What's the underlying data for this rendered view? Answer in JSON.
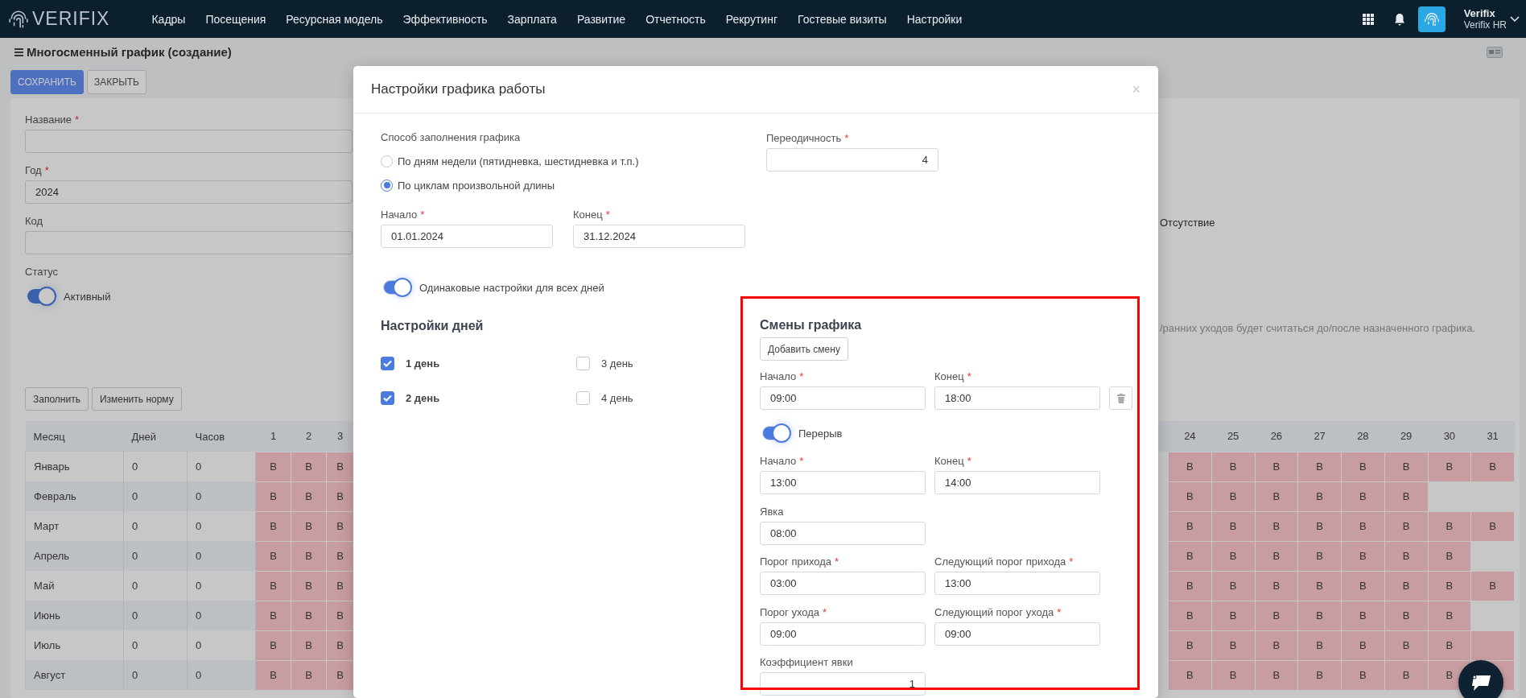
{
  "topbar": {
    "logo": "VERIFIX",
    "nav": [
      "Кадры",
      "Посещения",
      "Ресурсная модель",
      "Эффективность",
      "Зарплата",
      "Развитие",
      "Отчетность",
      "Рекрутинг",
      "Гостевые визиты",
      "Настройки"
    ],
    "user": {
      "name": "Verifix",
      "org": "Verifix HR"
    }
  },
  "page": {
    "title": "Многосменный график (создание)",
    "actions": [
      {
        "label": "СОХРАНИТЬ",
        "kind": "primary"
      },
      {
        "label": "ЗАКРЫТЬ",
        "kind": "default"
      }
    ],
    "fields": [
      {
        "label": "Название",
        "mark": "*"
      },
      {
        "label": "Год",
        "mark": "*",
        "value": "2024"
      },
      {
        "label": "Код"
      }
    ],
    "status": {
      "label": "Статус",
      "toggle": {
        "label": "Активный",
        "on": true
      }
    },
    "side_label": "Отсутствие",
    "hint": "/ранних уходов будет считаться до/после назначенного графика.",
    "table_buttons": [
      "Заполнить",
      "Изменить норму"
    ],
    "table": {
      "columns": [
        "Месяц",
        "Дней",
        "Часов",
        "1",
        "2",
        "3",
        "24",
        "25",
        "26",
        "27",
        "28",
        "29",
        "30",
        "31"
      ],
      "rows": [
        {
          "cells": [
            {
              "kind": "text",
              "text": "Январь"
            },
            {
              "kind": "text",
              "text": "0"
            },
            {
              "kind": "text",
              "text": "0"
            },
            {
              "kind": "weekend",
              "text": "В"
            },
            {
              "kind": "weekend",
              "text": "В"
            },
            {
              "kind": "weekend",
              "text": "В"
            },
            {
              "kind": "weekend",
              "text": "В"
            },
            {
              "kind": "weekend",
              "text": "В"
            },
            {
              "kind": "weekend",
              "text": "В"
            },
            {
              "kind": "weekend",
              "text": "В"
            },
            {
              "kind": "weekend",
              "text": "В"
            },
            {
              "kind": "weekend",
              "text": "В"
            },
            {
              "kind": "weekend",
              "text": "В"
            },
            {
              "kind": "weekend",
              "text": "В"
            }
          ]
        },
        {
          "cells": [
            {
              "kind": "text",
              "text": "Февраль"
            },
            {
              "kind": "text",
              "text": "0"
            },
            {
              "kind": "text",
              "text": "0"
            },
            {
              "kind": "weekend",
              "text": "В"
            },
            {
              "kind": "weekend",
              "text": "В"
            },
            {
              "kind": "weekend",
              "text": "В"
            },
            {
              "kind": "weekend",
              "text": "В"
            },
            {
              "kind": "weekend",
              "text": "В"
            },
            {
              "kind": "weekend",
              "text": "В"
            },
            {
              "kind": "weekend",
              "text": "В"
            },
            {
              "kind": "weekend",
              "text": "В"
            },
            {
              "kind": "weekend",
              "text": "В"
            },
            {
              "kind": "blank"
            },
            {
              "kind": "blank"
            }
          ]
        },
        {
          "cells": [
            {
              "kind": "text",
              "text": "Март"
            },
            {
              "kind": "text",
              "text": "0"
            },
            {
              "kind": "text",
              "text": "0"
            },
            {
              "kind": "weekend",
              "text": "В"
            },
            {
              "kind": "weekend",
              "text": "В"
            },
            {
              "kind": "weekend",
              "text": "В"
            },
            {
              "kind": "weekend",
              "text": "В"
            },
            {
              "kind": "weekend",
              "text": "В"
            },
            {
              "kind": "weekend",
              "text": "В"
            },
            {
              "kind": "weekend",
              "text": "В"
            },
            {
              "kind": "weekend",
              "text": "В"
            },
            {
              "kind": "weekend",
              "text": "В"
            },
            {
              "kind": "weekend",
              "text": "В"
            },
            {
              "kind": "weekend",
              "text": "В"
            }
          ]
        },
        {
          "cells": [
            {
              "kind": "text",
              "text": "Апрель"
            },
            {
              "kind": "text",
              "text": "0"
            },
            {
              "kind": "text",
              "text": "0"
            },
            {
              "kind": "weekend",
              "text": "В"
            },
            {
              "kind": "weekend",
              "text": "В"
            },
            {
              "kind": "weekend",
              "text": "В"
            },
            {
              "kind": "weekend",
              "text": "В"
            },
            {
              "kind": "weekend",
              "text": "В"
            },
            {
              "kind": "weekend",
              "text": "В"
            },
            {
              "kind": "weekend",
              "text": "В"
            },
            {
              "kind": "weekend",
              "text": "В"
            },
            {
              "kind": "weekend",
              "text": "В"
            },
            {
              "kind": "weekend",
              "text": "В"
            },
            {
              "kind": "blank"
            }
          ]
        },
        {
          "cells": [
            {
              "kind": "text",
              "text": "Май"
            },
            {
              "kind": "text",
              "text": "0"
            },
            {
              "kind": "text",
              "text": "0"
            },
            {
              "kind": "weekend",
              "text": "В"
            },
            {
              "kind": "weekend",
              "text": "В"
            },
            {
              "kind": "weekend",
              "text": "В"
            },
            {
              "kind": "weekend",
              "text": "В"
            },
            {
              "kind": "weekend",
              "text": "В"
            },
            {
              "kind": "weekend",
              "text": "В"
            },
            {
              "kind": "weekend",
              "text": "В"
            },
            {
              "kind": "weekend",
              "text": "В"
            },
            {
              "kind": "weekend",
              "text": "В"
            },
            {
              "kind": "weekend",
              "text": "В"
            },
            {
              "kind": "weekend",
              "text": "В"
            }
          ]
        },
        {
          "cells": [
            {
              "kind": "text",
              "text": "Июнь"
            },
            {
              "kind": "text",
              "text": "0"
            },
            {
              "kind": "text",
              "text": "0"
            },
            {
              "kind": "weekend",
              "text": "В"
            },
            {
              "kind": "weekend",
              "text": "В"
            },
            {
              "kind": "weekend",
              "text": "В"
            },
            {
              "kind": "weekend",
              "text": "В"
            },
            {
              "kind": "weekend",
              "text": "В"
            },
            {
              "kind": "weekend",
              "text": "В"
            },
            {
              "kind": "weekend",
              "text": "В"
            },
            {
              "kind": "weekend",
              "text": "В"
            },
            {
              "kind": "weekend",
              "text": "В"
            },
            {
              "kind": "weekend",
              "text": "В"
            },
            {
              "kind": "blank"
            }
          ]
        },
        {
          "cells": [
            {
              "kind": "text",
              "text": "Июль"
            },
            {
              "kind": "text",
              "text": "0"
            },
            {
              "kind": "text",
              "text": "0"
            },
            {
              "kind": "weekend",
              "text": "В"
            },
            {
              "kind": "weekend",
              "text": "В"
            },
            {
              "kind": "weekend",
              "text": "В"
            },
            {
              "kind": "weekend",
              "text": "В"
            },
            {
              "kind": "weekend",
              "text": "В"
            },
            {
              "kind": "weekend",
              "text": "В"
            },
            {
              "kind": "weekend",
              "text": "В"
            },
            {
              "kind": "weekend",
              "text": "В"
            },
            {
              "kind": "weekend",
              "text": "В"
            },
            {
              "kind": "weekend",
              "text": "В"
            },
            {
              "kind": "weekend"
            }
          ]
        },
        {
          "cells": [
            {
              "kind": "text",
              "text": "Август"
            },
            {
              "kind": "text",
              "text": "0"
            },
            {
              "kind": "text",
              "text": "0"
            },
            {
              "kind": "weekend",
              "text": "В"
            },
            {
              "kind": "weekend",
              "text": "В"
            },
            {
              "kind": "weekend",
              "text": "В"
            },
            {
              "kind": "weekend",
              "text": "В"
            },
            {
              "kind": "weekend",
              "text": "В"
            },
            {
              "kind": "weekend",
              "text": "В"
            },
            {
              "kind": "weekend",
              "text": "В"
            },
            {
              "kind": "weekend",
              "text": "В"
            },
            {
              "kind": "weekend",
              "text": "В"
            },
            {
              "kind": "weekend",
              "text": "В"
            },
            {
              "kind": "weekend"
            }
          ]
        }
      ]
    }
  },
  "modal": {
    "title": "Настройки графика работы",
    "close": "×",
    "method": {
      "label": "Способ заполнения графика",
      "options": [
        {
          "label": "По дням недели (пятидневка, шестидневка и т.п.)",
          "selected": false
        },
        {
          "label": "По циклам произвольной длины",
          "selected": true
        }
      ]
    },
    "dates": [
      {
        "label": "Начало",
        "mark": "*",
        "value": "01.01.2024"
      },
      {
        "label": "Конец",
        "mark": "*",
        "value": "31.12.2024"
      }
    ],
    "periodicity": {
      "label": "Переодичность",
      "mark": "*",
      "value": "4",
      "kind": "number"
    },
    "same_settings": {
      "label": "Одинаковые настройки для всех дней",
      "on": true
    },
    "days_title": "Настройки дней",
    "days": [
      {
        "label": "1 день",
        "checked": true
      },
      {
        "label": "2 день",
        "checked": true
      },
      {
        "label": "3 день",
        "checked": false
      },
      {
        "label": "4 день",
        "checked": false
      }
    ],
    "shifts": {
      "title": "Смены графика",
      "add_button": "Добавить смену",
      "time": [
        {
          "label": "Начало",
          "mark": "*",
          "value": "09:00"
        },
        {
          "label": "Конец",
          "mark": "*",
          "value": "18:00"
        }
      ],
      "break": {
        "label": "Перерыв",
        "on": true
      },
      "break_time": [
        {
          "label": "Начало",
          "mark": "*",
          "value": "13:00"
        },
        {
          "label": "Конец",
          "mark": "*",
          "value": "14:00"
        }
      ],
      "attendance": [
        {
          "label": "Явка",
          "value": "08:00"
        }
      ],
      "arrival": [
        {
          "label": "Порог прихода",
          "mark": "*",
          "value": "03:00"
        },
        {
          "label": "Следующий порог прихода",
          "mark": "*",
          "value": "13:00"
        }
      ],
      "departure": [
        {
          "label": "Порог ухода",
          "mark": "*",
          "value": "09:00"
        },
        {
          "label": "Следующий порог ухода",
          "mark": "*",
          "value": "09:00"
        }
      ],
      "coefficient": [
        {
          "label": "Коэффициент явки",
          "value": "1",
          "kind": "number"
        }
      ]
    }
  }
}
